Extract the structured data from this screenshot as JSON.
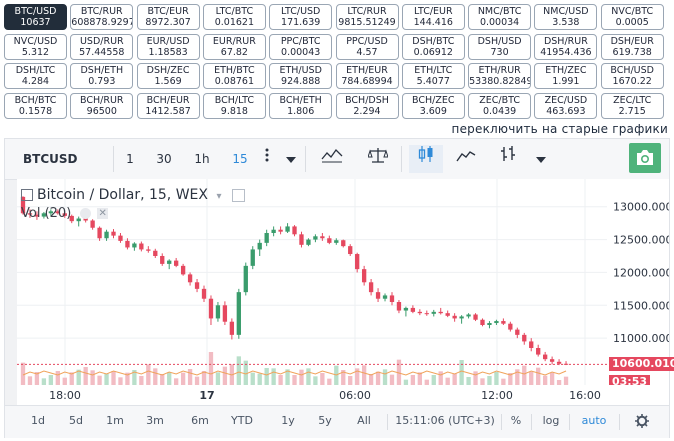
{
  "pairs": [
    {
      "name": "BTC/USD",
      "value": "10637"
    },
    {
      "name": "BTC/RUR",
      "value": "608878.9297"
    },
    {
      "name": "BTC/EUR",
      "value": "8972.307"
    },
    {
      "name": "LTC/BTC",
      "value": "0.01621"
    },
    {
      "name": "LTC/USD",
      "value": "171.639"
    },
    {
      "name": "LTC/RUR",
      "value": "9815.51249"
    },
    {
      "name": "LTC/EUR",
      "value": "144.416"
    },
    {
      "name": "NMC/BTC",
      "value": "0.00034"
    },
    {
      "name": "NMC/USD",
      "value": "3.538"
    },
    {
      "name": "NVC/BTC",
      "value": "0.0005"
    },
    {
      "name": "NVC/USD",
      "value": "5.312"
    },
    {
      "name": "USD/RUR",
      "value": "57.44558"
    },
    {
      "name": "EUR/USD",
      "value": "1.18583"
    },
    {
      "name": "EUR/RUR",
      "value": "67.82"
    },
    {
      "name": "PPC/BTC",
      "value": "0.00043"
    },
    {
      "name": "PPC/USD",
      "value": "4.57"
    },
    {
      "name": "DSH/BTC",
      "value": "0.06912"
    },
    {
      "name": "DSH/USD",
      "value": "730"
    },
    {
      "name": "DSH/RUR",
      "value": "41954.436"
    },
    {
      "name": "DSH/EUR",
      "value": "619.738"
    },
    {
      "name": "DSH/LTC",
      "value": "4.284"
    },
    {
      "name": "DSH/ETH",
      "value": "0.793"
    },
    {
      "name": "DSH/ZEC",
      "value": "1.569"
    },
    {
      "name": "ETH/BTC",
      "value": "0.08761"
    },
    {
      "name": "ETH/USD",
      "value": "924.888"
    },
    {
      "name": "ETH/EUR",
      "value": "784.68994"
    },
    {
      "name": "ETH/LTC",
      "value": "5.4077"
    },
    {
      "name": "ETH/RUR",
      "value": "53380.82849"
    },
    {
      "name": "ETH/ZEC",
      "value": "1.991"
    },
    {
      "name": "BCH/USD",
      "value": "1670.22"
    },
    {
      "name": "BCH/BTC",
      "value": "0.1578"
    },
    {
      "name": "BCH/RUR",
      "value": "96500"
    },
    {
      "name": "BCH/EUR",
      "value": "1412.587"
    },
    {
      "name": "BCH/LTC",
      "value": "9.818"
    },
    {
      "name": "BCH/ETH",
      "value": "1.806"
    },
    {
      "name": "BCH/DSH",
      "value": "2.294"
    },
    {
      "name": "BCH/ZEC",
      "value": "3.609"
    },
    {
      "name": "ZEC/BTC",
      "value": "0.0439"
    },
    {
      "name": "ZEC/USD",
      "value": "463.693"
    },
    {
      "name": "ZEC/LTC",
      "value": "2.715"
    }
  ],
  "old_charts_link": "переключить на старые графики",
  "toolbar": {
    "symbol": "BTCUSD",
    "intervals": [
      "1",
      "30",
      "1h",
      "15"
    ],
    "active_interval": "15"
  },
  "legend": {
    "title": "Bitcoin / Dollar, 15, WEX",
    "volume_label": "Vol (20)"
  },
  "y_axis": {
    "labels": [
      "13000.000",
      "12500.000",
      "12000.000",
      "11500.000",
      "11000.000"
    ],
    "current_price": "10600.010",
    "countdown": "03:53"
  },
  "x_axis": {
    "labels": [
      "18:00",
      "17",
      "06:00",
      "12:00",
      "16:00"
    ]
  },
  "bottom_bar": {
    "ranges": [
      "1d",
      "5d",
      "1m",
      "3m",
      "6m",
      "YTD",
      "1y",
      "5y",
      "All"
    ],
    "time": "15:11:06 (UTC+3)",
    "percent": "%",
    "log": "log",
    "auto": "auto"
  },
  "colors": {
    "up": "#3a9c6c",
    "down": "#e5485f",
    "up_vol": "#b9dfca",
    "down_vol": "#f2bcc3",
    "accent": "#2f8ad8"
  },
  "chart_data": {
    "type": "candlestick",
    "title": "Bitcoin / Dollar, 15, WEX",
    "ylim": [
      10500,
      13300
    ],
    "x_ticks": [
      "18:00",
      "17",
      "06:00",
      "12:00",
      "16:00"
    ],
    "y_ticks": [
      13000,
      12500,
      12000,
      11500,
      11000
    ],
    "last_price": 10600.01,
    "candles": [
      [
        13150,
        13160,
        12880,
        12900
      ],
      [
        12900,
        12960,
        12830,
        12880
      ],
      [
        12880,
        12930,
        12800,
        12850
      ],
      [
        12850,
        12920,
        12820,
        12900
      ],
      [
        12900,
        12960,
        12860,
        12930
      ],
      [
        12930,
        12960,
        12880,
        12900
      ],
      [
        12900,
        12930,
        12830,
        12860
      ],
      [
        12860,
        12880,
        12750,
        12780
      ],
      [
        12780,
        12850,
        12700,
        12820
      ],
      [
        12820,
        12850,
        12760,
        12790
      ],
      [
        12790,
        12810,
        12650,
        12680
      ],
      [
        12680,
        12700,
        12480,
        12520
      ],
      [
        12520,
        12650,
        12480,
        12620
      ],
      [
        12620,
        12660,
        12520,
        12560
      ],
      [
        12560,
        12600,
        12450,
        12480
      ],
      [
        12480,
        12520,
        12350,
        12380
      ],
      [
        12380,
        12460,
        12330,
        12440
      ],
      [
        12440,
        12470,
        12320,
        12350
      ],
      [
        12350,
        12400,
        12300,
        12330
      ],
      [
        12330,
        12360,
        12220,
        12250
      ],
      [
        12250,
        12290,
        12100,
        12130
      ],
      [
        12130,
        12200,
        12050,
        12180
      ],
      [
        12180,
        12220,
        12080,
        12100
      ],
      [
        12100,
        12130,
        11950,
        11970
      ],
      [
        11970,
        12000,
        11800,
        11850
      ],
      [
        11850,
        11900,
        11700,
        11750
      ],
      [
        11750,
        11800,
        11550,
        11600
      ],
      [
        11600,
        11650,
        11200,
        11300
      ],
      [
        11300,
        11550,
        11250,
        11500
      ],
      [
        11500,
        11560,
        11200,
        11250
      ],
      [
        11250,
        11300,
        10980,
        11050
      ],
      [
        11050,
        11750,
        10990,
        11700
      ],
      [
        11700,
        12150,
        11650,
        12100
      ],
      [
        12100,
        12400,
        12050,
        12350
      ],
      [
        12350,
        12500,
        12250,
        12450
      ],
      [
        12450,
        12650,
        12400,
        12600
      ],
      [
        12600,
        12700,
        12550,
        12650
      ],
      [
        12650,
        12700,
        12580,
        12620
      ],
      [
        12620,
        12750,
        12600,
        12700
      ],
      [
        12700,
        12720,
        12550,
        12580
      ],
      [
        12580,
        12620,
        12380,
        12420
      ],
      [
        12420,
        12520,
        12400,
        12500
      ],
      [
        12500,
        12580,
        12460,
        12550
      ],
      [
        12550,
        12600,
        12480,
        12520
      ],
      [
        12520,
        12560,
        12430,
        12450
      ],
      [
        12450,
        12520,
        12420,
        12490
      ],
      [
        12490,
        12500,
        12380,
        12400
      ],
      [
        12400,
        12430,
        12250,
        12280
      ],
      [
        12280,
        12300,
        12000,
        12050
      ],
      [
        12050,
        12100,
        11800,
        11850
      ],
      [
        11850,
        11900,
        11650,
        11700
      ],
      [
        11700,
        11760,
        11550,
        11600
      ],
      [
        11600,
        11680,
        11560,
        11650
      ],
      [
        11650,
        11700,
        11500,
        11550
      ],
      [
        11550,
        11580,
        11380,
        11420
      ],
      [
        11420,
        11480,
        11330,
        11460
      ],
      [
        11460,
        11500,
        11380,
        11400
      ],
      [
        11400,
        11440,
        11350,
        11380
      ],
      [
        11380,
        11420,
        11340,
        11370
      ],
      [
        11370,
        11430,
        11330,
        11400
      ],
      [
        11400,
        11460,
        11360,
        11380
      ],
      [
        11380,
        11420,
        11320,
        11340
      ],
      [
        11340,
        11380,
        11250,
        11300
      ],
      [
        11300,
        11350,
        11220,
        11330
      ],
      [
        11330,
        11380,
        11300,
        11360
      ],
      [
        11360,
        11380,
        11260,
        11280
      ],
      [
        11280,
        11300,
        11180,
        11200
      ],
      [
        11200,
        11260,
        11150,
        11230
      ],
      [
        11230,
        11280,
        11200,
        11260
      ],
      [
        11260,
        11300,
        11200,
        11220
      ],
      [
        11220,
        11250,
        11100,
        11130
      ],
      [
        11130,
        11160,
        11000,
        11050
      ],
      [
        11050,
        11080,
        10900,
        10950
      ],
      [
        10950,
        11000,
        10800,
        10850
      ],
      [
        10850,
        10900,
        10720,
        10750
      ],
      [
        10750,
        10790,
        10650,
        10680
      ],
      [
        10680,
        10720,
        10600,
        10640
      ],
      [
        10640,
        10680,
        10590,
        10610
      ],
      [
        10610,
        10650,
        10590,
        10600
      ]
    ]
  }
}
